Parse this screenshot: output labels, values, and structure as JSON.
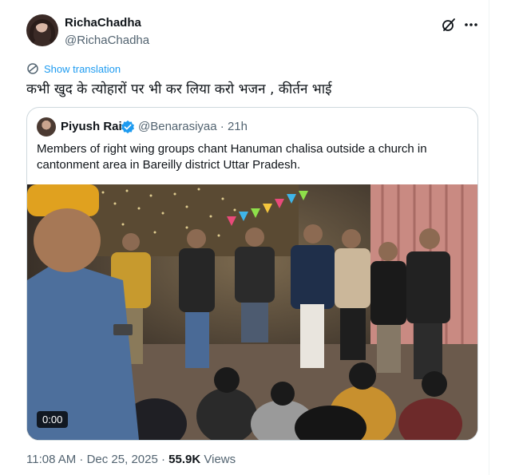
{
  "tweet": {
    "author": {
      "display_name": "RichaChadha",
      "handle": "@RichaChadha"
    },
    "show_translation": "Show translation",
    "text": "कभी खुद के त्योहारों पर भी कर लिया करो भजन , कीर्तन भाई",
    "timestamp": "11:08 AM · Dec 25, 2025",
    "separator": " · ",
    "views_count": "55.9K",
    "views_label": "Views"
  },
  "quoted": {
    "display_name": "Piyush Rai",
    "handle": "@Benarasiyaa",
    "age": "· 21h",
    "text": "Members of right wing groups chant Hanuman chalisa outside a church in cantonment area in Bareilly district Uttar Pradesh.",
    "video_time": "0:00"
  },
  "icons": {
    "grok": "grok-icon",
    "more": "more-icon",
    "translate": "globe-icon",
    "verified": "verified-badge-icon"
  },
  "colors": {
    "accent": "#1d9bf0",
    "muted": "#536471",
    "text": "#0f1419",
    "border": "#cfd9de"
  }
}
